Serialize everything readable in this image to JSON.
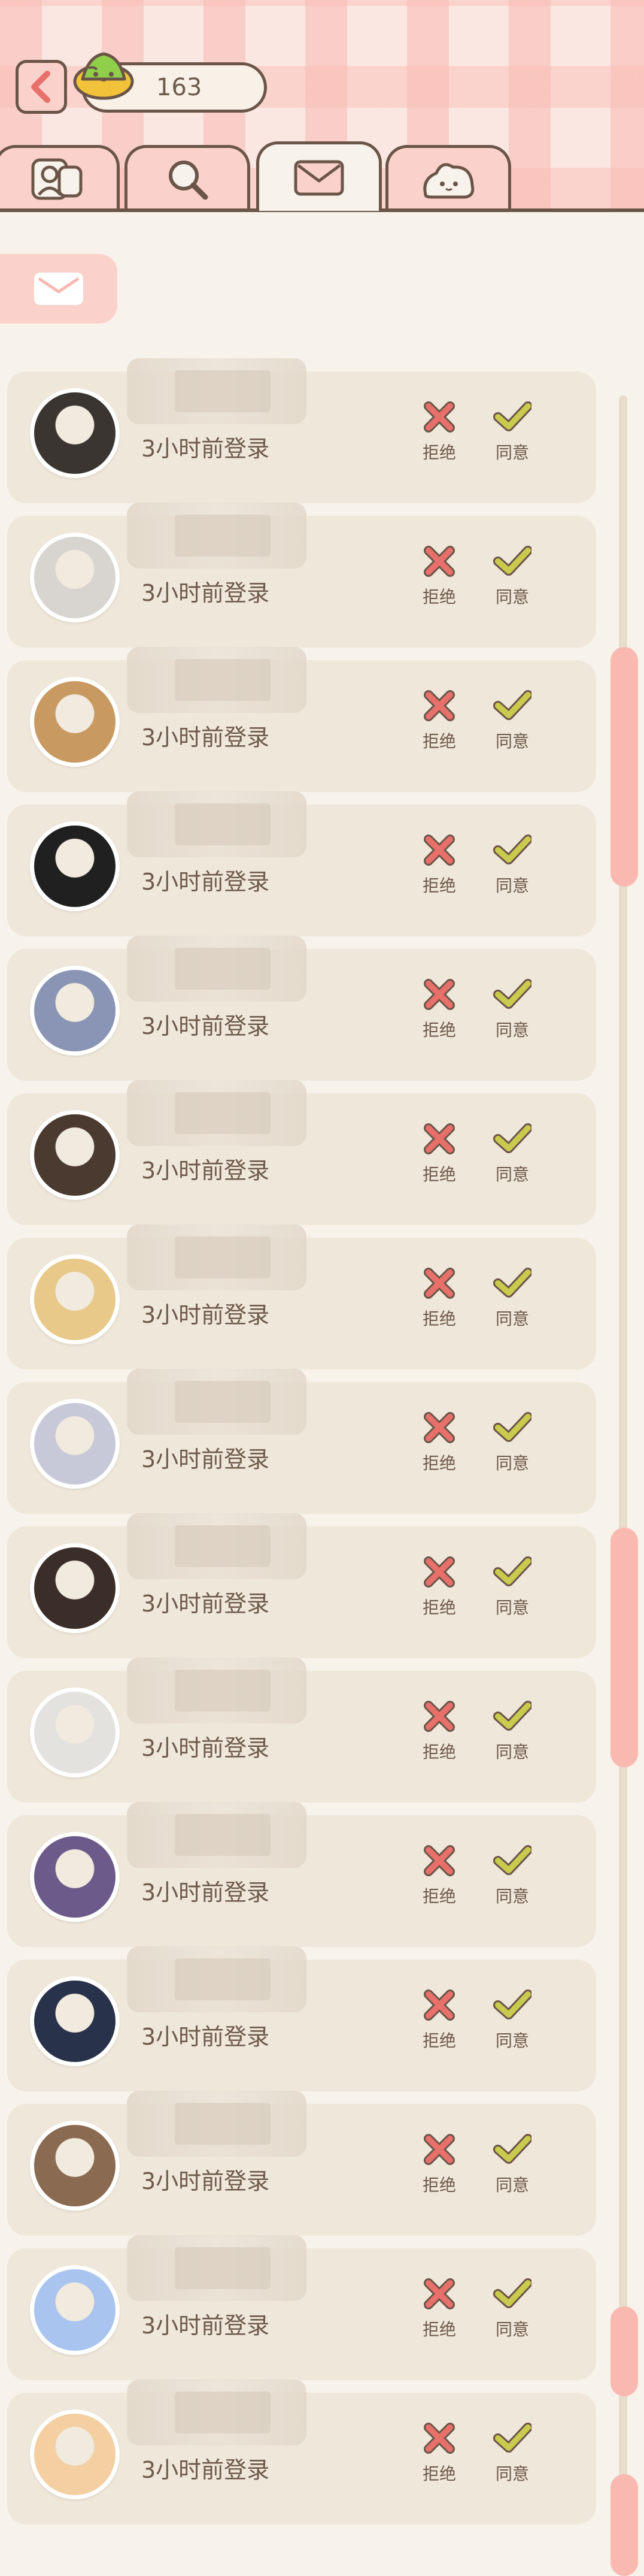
{
  "header": {
    "coin_count": "163",
    "tabs": [
      {
        "name": "tab-profile",
        "icon": "person-card-icon",
        "active": false
      },
      {
        "name": "tab-search",
        "icon": "magnifier-icon",
        "active": false
      },
      {
        "name": "tab-mail",
        "icon": "envelope-icon",
        "active": true
      },
      {
        "name": "tab-pet",
        "icon": "blob-face-icon",
        "active": false
      }
    ]
  },
  "filter": {
    "icon": "envelope-icon"
  },
  "requests": [
    {
      "status": "3小时前登录",
      "reject": "拒绝",
      "accept": "同意",
      "avatar_color": "#3a3530"
    },
    {
      "status": "3小时前登录",
      "reject": "拒绝",
      "accept": "同意",
      "avatar_color": "#d8d4d0"
    },
    {
      "status": "3小时前登录",
      "reject": "拒绝",
      "accept": "同意",
      "avatar_color": "#c89a62"
    },
    {
      "status": "3小时前登录",
      "reject": "拒绝",
      "accept": "同意",
      "avatar_color": "#202020"
    },
    {
      "status": "3小时前登录",
      "reject": "拒绝",
      "accept": "同意",
      "avatar_color": "#8a94b4"
    },
    {
      "status": "3小时前登录",
      "reject": "拒绝",
      "accept": "同意",
      "avatar_color": "#4b3a30"
    },
    {
      "status": "3小时前登录",
      "reject": "拒绝",
      "accept": "同意",
      "avatar_color": "#e9c98a"
    },
    {
      "status": "3小时前登录",
      "reject": "拒绝",
      "accept": "同意",
      "avatar_color": "#c7c9d8"
    },
    {
      "status": "3小时前登录",
      "reject": "拒绝",
      "accept": "同意",
      "avatar_color": "#3b2e28"
    },
    {
      "status": "3小时前登录",
      "reject": "拒绝",
      "accept": "同意",
      "avatar_color": "#e4e2df"
    },
    {
      "status": "3小时前登录",
      "reject": "拒绝",
      "accept": "同意",
      "avatar_color": "#6c5a8a"
    },
    {
      "status": "3小时前登录",
      "reject": "拒绝",
      "accept": "同意",
      "avatar_color": "#28324a"
    },
    {
      "status": "3小时前登录",
      "reject": "拒绝",
      "accept": "同意",
      "avatar_color": "#8a6a50"
    },
    {
      "status": "3小时前登录",
      "reject": "拒绝",
      "accept": "同意",
      "avatar_color": "#a9c4ef"
    },
    {
      "status": "3小时前登录",
      "reject": "拒绝",
      "accept": "同意",
      "avatar_color": "#f3cfa1"
    }
  ],
  "colors": {
    "reject": "#e8706a",
    "accept": "#c9cb4e",
    "outline": "#6b5549",
    "accent_pink": "#f9b9b1"
  }
}
